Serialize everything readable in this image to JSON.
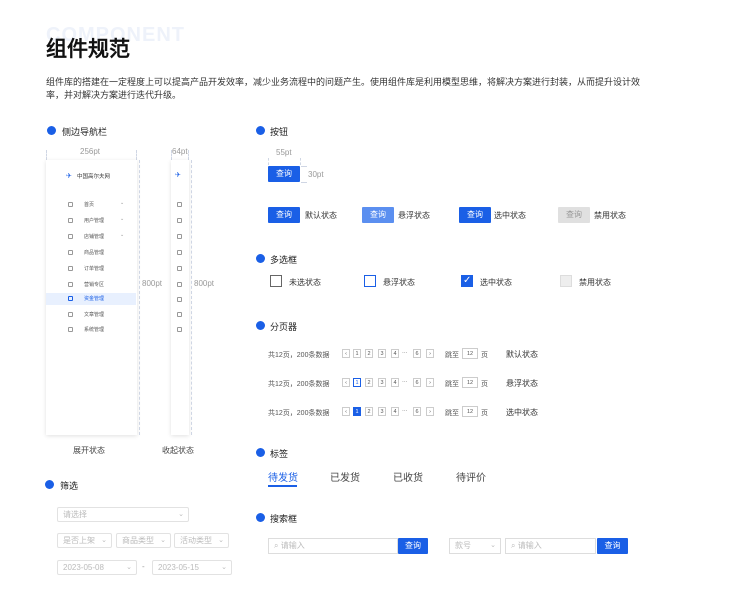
{
  "page": {
    "watermark": "COMPONENT",
    "title": "组件规范",
    "description": "组件库的搭建在一定程度上可以提高产品开发效率，减少业务流程中的问题产生。使用组件库是利用模型思维，将解决方案进行封装，从而提升设计效率，并对解决方案进行迭代升级。"
  },
  "colors": {
    "primary": "#1a5fe6",
    "hover": "#5b8ff0",
    "disabled": "#e0e0e0"
  },
  "sidenav": {
    "section_title": "侧边导航栏",
    "width_label": "256pt",
    "collapsed_width_label": "64pt",
    "height_label": "800pt",
    "collapsed_height_label": "800pt",
    "logo_text": "中国高尔夫网",
    "items": [
      {
        "label": "首页",
        "icon": "home-icon"
      },
      {
        "label": "用户管理",
        "icon": "user-icon"
      },
      {
        "label": "店铺管理",
        "icon": "store-icon"
      },
      {
        "label": "商品管理",
        "icon": "goods-icon"
      },
      {
        "label": "订单管理",
        "icon": "order-icon"
      },
      {
        "label": "营销专区",
        "icon": "marketing-icon"
      },
      {
        "label": "资金管理",
        "icon": "fund-icon"
      },
      {
        "label": "文章管理",
        "icon": "article-icon"
      },
      {
        "label": "系统管理",
        "icon": "system-icon"
      }
    ],
    "expanded_caption": "展开状态",
    "collapsed_caption": "收起状态"
  },
  "buttons": {
    "section_title": "按钮",
    "width_label": "55pt",
    "height_label": "30pt",
    "label": "查询",
    "states": [
      "默认状态",
      "悬浮状态",
      "选中状态",
      "禁用状态"
    ]
  },
  "checkbox": {
    "section_title": "多选框",
    "states": [
      "未选状态",
      "悬浮状态",
      "选中状态",
      "禁用状态"
    ],
    "check_mark": "✓"
  },
  "pagination": {
    "section_title": "分页器",
    "summary": "共12页，200条数据",
    "prev": "‹",
    "next": "›",
    "pages": [
      "1",
      "2",
      "3",
      "4",
      "···",
      "6"
    ],
    "jump_label": "跳至",
    "jump_value": "12",
    "page_unit": "页",
    "states": [
      "默认状态",
      "悬浮状态",
      "选中状态"
    ]
  },
  "tabs": {
    "section_title": "标签",
    "items": [
      "待发货",
      "已发货",
      "已收货",
      "待评价"
    ]
  },
  "filter": {
    "section_title": "筛选",
    "select_placeholder": "请选择",
    "chips": [
      "是否上架",
      "商品类型",
      "活动类型"
    ],
    "date_start": "2023-05-08",
    "date_sep": "-",
    "date_end": "2023-05-15",
    "chevron": "⌄"
  },
  "search": {
    "section_title": "搜索框",
    "placeholder": "请输入",
    "button_label": "查询",
    "select_value": "款号",
    "search_glyph": "⌕"
  }
}
